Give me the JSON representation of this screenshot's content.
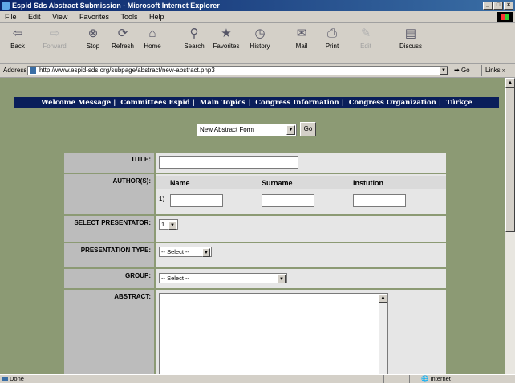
{
  "window": {
    "title": "Espid Sds Abstract Submission - Microsoft Internet Explorer"
  },
  "menu": [
    "File",
    "Edit",
    "View",
    "Favorites",
    "Tools",
    "Help"
  ],
  "toolbar": [
    {
      "label": "Back",
      "icon": "back-arrow-icon",
      "enabled": true
    },
    {
      "label": "Forward",
      "icon": "forward-arrow-icon",
      "enabled": false
    },
    {
      "label": "Stop",
      "icon": "stop-icon",
      "enabled": true
    },
    {
      "label": "Refresh",
      "icon": "refresh-icon",
      "enabled": true
    },
    {
      "label": "Home",
      "icon": "home-icon",
      "enabled": true
    },
    {
      "label": "Search",
      "icon": "search-icon",
      "enabled": true
    },
    {
      "label": "Favorites",
      "icon": "favorites-icon",
      "enabled": true
    },
    {
      "label": "History",
      "icon": "history-icon",
      "enabled": true
    },
    {
      "label": "Mail",
      "icon": "mail-icon",
      "enabled": true
    },
    {
      "label": "Print",
      "icon": "print-icon",
      "enabled": true
    },
    {
      "label": "Edit",
      "icon": "edit-icon",
      "enabled": false
    },
    {
      "label": "Discuss",
      "icon": "discuss-icon",
      "enabled": true
    }
  ],
  "address": {
    "label": "Address",
    "url": "http://www.espid-sds.org/subpage/abstract/new-abstract.php3",
    "go": "Go",
    "links": "Links"
  },
  "nav": [
    "Welcome Message",
    "Committees Espid",
    "Main Topics",
    "Congress Information",
    "Congress Organization",
    "Türkçe"
  ],
  "form_select": {
    "value": "New Abstract Form",
    "go": "Go"
  },
  "form": {
    "title_label": "TITLE:",
    "authors_label": "AUTHOR(S):",
    "col_name": "Name",
    "col_surname": "Surname",
    "col_institution": "Instution",
    "row_number": "1)",
    "presenter_label": "SELECT PRESENTATOR:",
    "presenter_value": "1",
    "type_label": "PRESENTATION TYPE:",
    "type_value": "-- Select --",
    "group_label": "GROUP:",
    "group_value": "-- Select --",
    "abstract_label": "ABSTRACT:"
  },
  "status": {
    "text": "Done",
    "zone": "Internet"
  },
  "colors": {
    "page_background": "#8c9a74",
    "nav_background": "#0a1e5a",
    "label_cell": "#bcbcbc",
    "value_cell": "#e6e6e6"
  }
}
